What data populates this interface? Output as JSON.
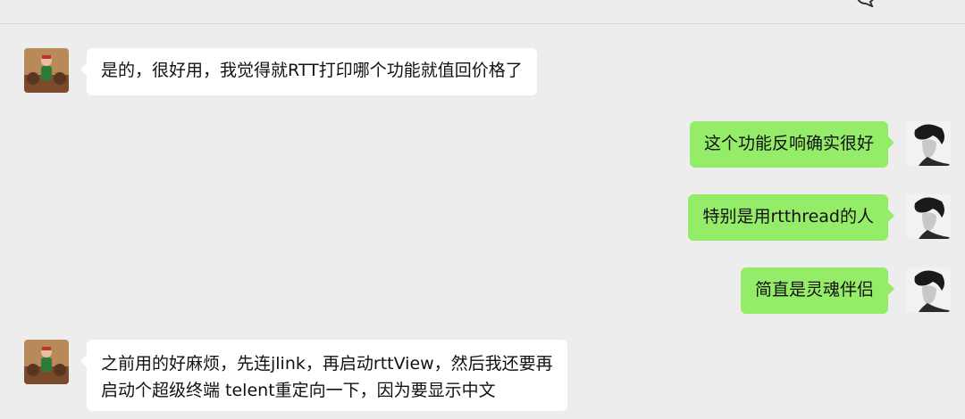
{
  "colors": {
    "background": "#ededed",
    "incoming_bubble": "#ffffff",
    "outgoing_bubble": "#95ec69"
  },
  "header": {
    "icon": "chat-bubble-icon"
  },
  "messages": [
    {
      "direction": "incoming",
      "avatar": "avatar-contact",
      "lines": [
        "是的，很好用，我觉得就RTT打印哪个功能就值回价格了"
      ]
    },
    {
      "direction": "outgoing",
      "avatar": "avatar-self",
      "lines": [
        "这个功能反响确实很好"
      ]
    },
    {
      "direction": "outgoing",
      "avatar": "avatar-self",
      "lines": [
        "特别是用rtthread的人"
      ]
    },
    {
      "direction": "outgoing",
      "avatar": "avatar-self",
      "lines": [
        "简直是灵魂伴侣"
      ]
    },
    {
      "direction": "incoming",
      "avatar": "avatar-contact",
      "lines": [
        "之前用的好麻烦，先连jlink，再启动rttView，然后我还要再",
        "启动个超级终端 telent重定向一下，因为要显示中文"
      ]
    }
  ]
}
